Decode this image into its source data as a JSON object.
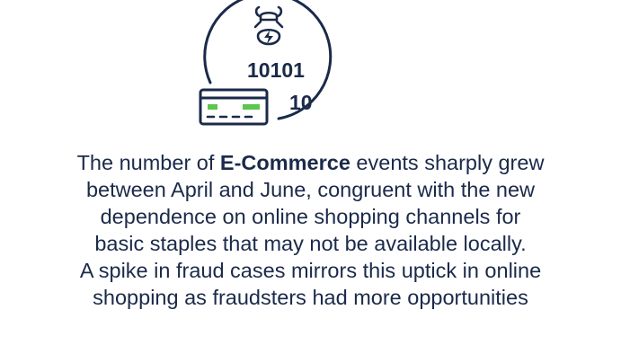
{
  "emblem": {
    "icon": "ecommerce-fraud-icon",
    "binary_top": "10101",
    "binary_bottom": "10",
    "stroke_color": "#1b2a4a",
    "accent_color": "#5cc64e"
  },
  "paragraph": {
    "line1_prefix": "The number of ",
    "line1_bold": "E-Commerce",
    "line1_suffix": " events sharply grew",
    "line2": "between April and June, congruent with the new",
    "line3": "dependence on online shopping channels for",
    "line4": "basic staples that may not be available locally.",
    "line5": "A spike in fraud cases mirrors this uptick in online",
    "line6": "shopping as fraudsters had more opportunities"
  }
}
